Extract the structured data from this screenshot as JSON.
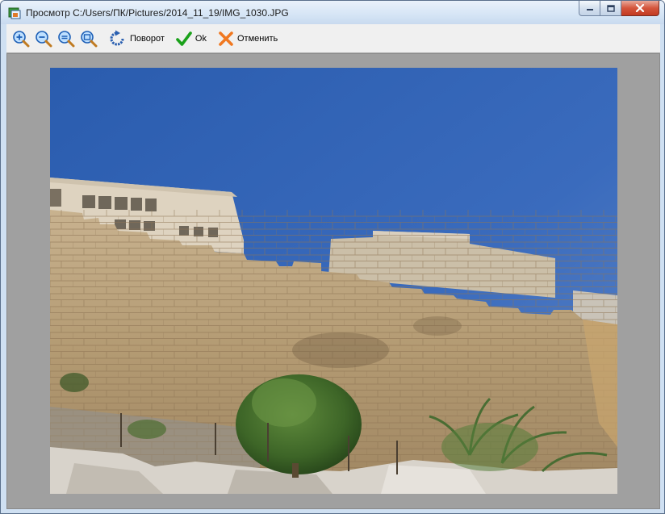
{
  "window": {
    "title": "Просмотр C:/Users/ПК/Pictures/2014_11_19/IMG_1030.JPG"
  },
  "toolbar": {
    "zoom_in": {
      "icon": "zoom-in-icon"
    },
    "zoom_out": {
      "icon": "zoom-out-icon"
    },
    "zoom_fit": {
      "icon": "zoom-fit-icon"
    },
    "zoom_actual": {
      "icon": "zoom-actual-size-icon"
    },
    "rotate": {
      "icon": "rotate-icon",
      "label": "Поворот"
    },
    "ok": {
      "icon": "checkmark-icon",
      "label": "Ok",
      "color": "#1aa11a"
    },
    "cancel": {
      "icon": "cross-icon",
      "label": "Отменить",
      "color": "#f07820"
    }
  },
  "viewer": {
    "background": "#a0a0a0",
    "image": "photo of a stone city wall under a blue sky with a shrub in the foreground"
  }
}
